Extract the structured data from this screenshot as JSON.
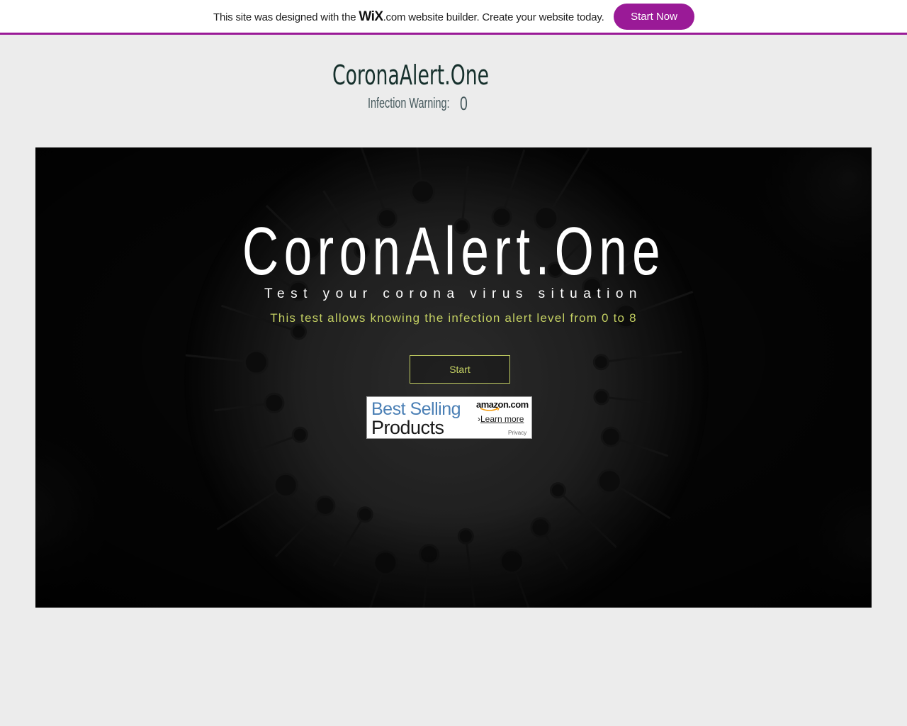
{
  "banner": {
    "text_before": "This site was designed with the ",
    "logo": "WiX",
    "text_after": ".com website builder. Create your website today.",
    "cta_label": "Start Now",
    "accent_color": "#9a1a97"
  },
  "header": {
    "site_title": "CoronaAlert.One",
    "warning_label": "Infection Warning:",
    "warning_value": "0"
  },
  "hero": {
    "title": "CoronAlert.One",
    "subtitle": "Test your corona virus situation",
    "description": "This test allows knowing the infection alert level from 0 to 8",
    "button_label": "Start",
    "accent_color": "#c3cf62"
  },
  "ad": {
    "line1": "Best Selling",
    "line2": "Products",
    "brand": "amazon.com",
    "learn_more": "Learn more",
    "privacy": "Privacy"
  }
}
